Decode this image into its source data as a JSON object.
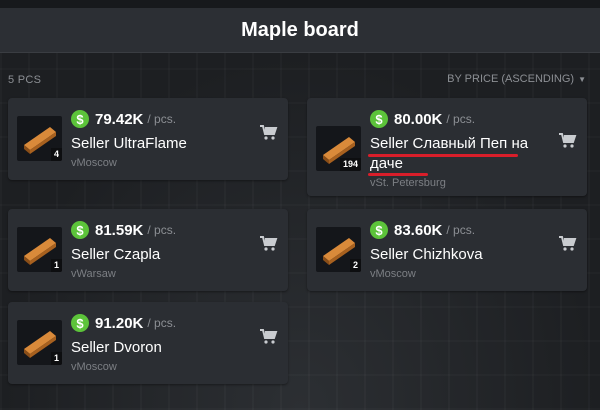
{
  "header": {
    "title": "Maple board"
  },
  "toolbar": {
    "count": "5 PCS",
    "sort_label": "BY PRICE (ASCENDING)"
  },
  "colors": {
    "accent_green": "#5cc33a",
    "annotation_red": "#d91e2a"
  },
  "listings": [
    {
      "price": "79.42K",
      "unit": "/ pcs.",
      "seller": "Seller UltraFlame",
      "city": "vMoscow",
      "qty": "4"
    },
    {
      "price": "80.00K",
      "unit": "/ pcs.",
      "seller": "Seller Славный Пеп на даче",
      "city": "vSt. Petersburg",
      "qty": "194"
    },
    {
      "price": "81.59K",
      "unit": "/ pcs.",
      "seller": "Seller Czapla",
      "city": "vWarsaw",
      "qty": "1"
    },
    {
      "price": "83.60K",
      "unit": "/ pcs.",
      "seller": "Seller Chizhkova",
      "city": "vMoscow",
      "qty": "2"
    },
    {
      "price": "91.20K",
      "unit": "/ pcs.",
      "seller": "Seller Dvoron",
      "city": "vMoscow",
      "qty": "1"
    }
  ],
  "icons": {
    "currency": "dollar-icon",
    "cart": "cart-icon",
    "item": "maple-board-icon",
    "sort": "caret-down-icon"
  }
}
